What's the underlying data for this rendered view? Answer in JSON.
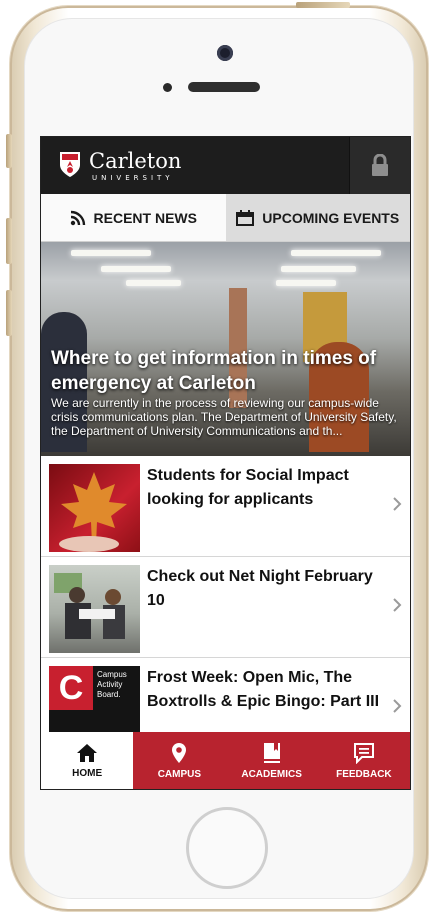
{
  "app": {
    "logo_name": "Carleton",
    "logo_sub": "UNIVERSITY",
    "lock_icon": "lock-icon"
  },
  "tabs": [
    {
      "label": "RECENT NEWS",
      "icon": "rss-icon",
      "active": true
    },
    {
      "label": "UPCOMING EVENTS",
      "icon": "calendar-icon",
      "active": false
    }
  ],
  "featured": {
    "title": "Where to get information in times of emergency at Carleton",
    "description": "We are currently in the process of reviewing our campus-wide crisis communications plan. The Department of University Safety, the Department of University Communications and th..."
  },
  "news": [
    {
      "title": "Students for Social Impact looking for applicants"
    },
    {
      "title": "Check out Net Night February 10"
    },
    {
      "title": "Frost Week: Open Mic, The Boxtrolls & Epic Bingo: Part III",
      "thumb_letter": "C",
      "thumb_text": "Campus Activity Board."
    }
  ],
  "nav": [
    {
      "label": "HOME",
      "icon": "home-icon",
      "active": true
    },
    {
      "label": "CAMPUS",
      "icon": "map-pin-icon",
      "active": false
    },
    {
      "label": "ACADEMICS",
      "icon": "book-icon",
      "active": false
    },
    {
      "label": "FEEDBACK",
      "icon": "chat-icon",
      "active": false
    }
  ],
  "colors": {
    "brand_red": "#b8232f",
    "appbar": "#1d1d1d",
    "inactive_tab": "#dcdcdc"
  }
}
